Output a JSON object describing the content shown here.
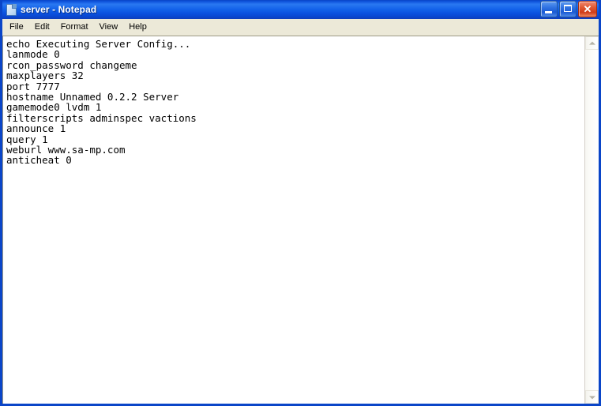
{
  "window": {
    "title": "server - Notepad",
    "icon": "notepad-document-icon",
    "accent_color": "#0a45c8",
    "titlebar_gradient_top": "#0a44c4",
    "titlebar_gradient_mid": "#2a78f0",
    "menubar_color": "#ece9d8"
  },
  "caption_buttons": {
    "minimize": {
      "name": "minimize-button",
      "tooltip": "Minimize"
    },
    "maximize": {
      "name": "maximize-button",
      "tooltip": "Maximize"
    },
    "close": {
      "name": "close-button",
      "tooltip": "Close",
      "color": "#cf3c18",
      "glyph": "✕"
    }
  },
  "menu": {
    "items": [
      {
        "label": "File"
      },
      {
        "label": "Edit"
      },
      {
        "label": "Format"
      },
      {
        "label": "View"
      },
      {
        "label": "Help"
      }
    ]
  },
  "editor": {
    "lines": [
      "echo Executing Server Config...",
      "lanmode 0",
      "rcon_password changeme",
      "maxplayers 32",
      "port 7777",
      "hostname Unnamed 0.2.2 Server",
      "gamemode0 lvdm 1",
      "filterscripts adminspec vactions",
      "announce 1",
      "query 1",
      "weburl www.sa-mp.com",
      "anticheat 0"
    ]
  },
  "scrollbar": {
    "up_arrow": "▲",
    "down_arrow": "▼",
    "state": "disabled"
  }
}
